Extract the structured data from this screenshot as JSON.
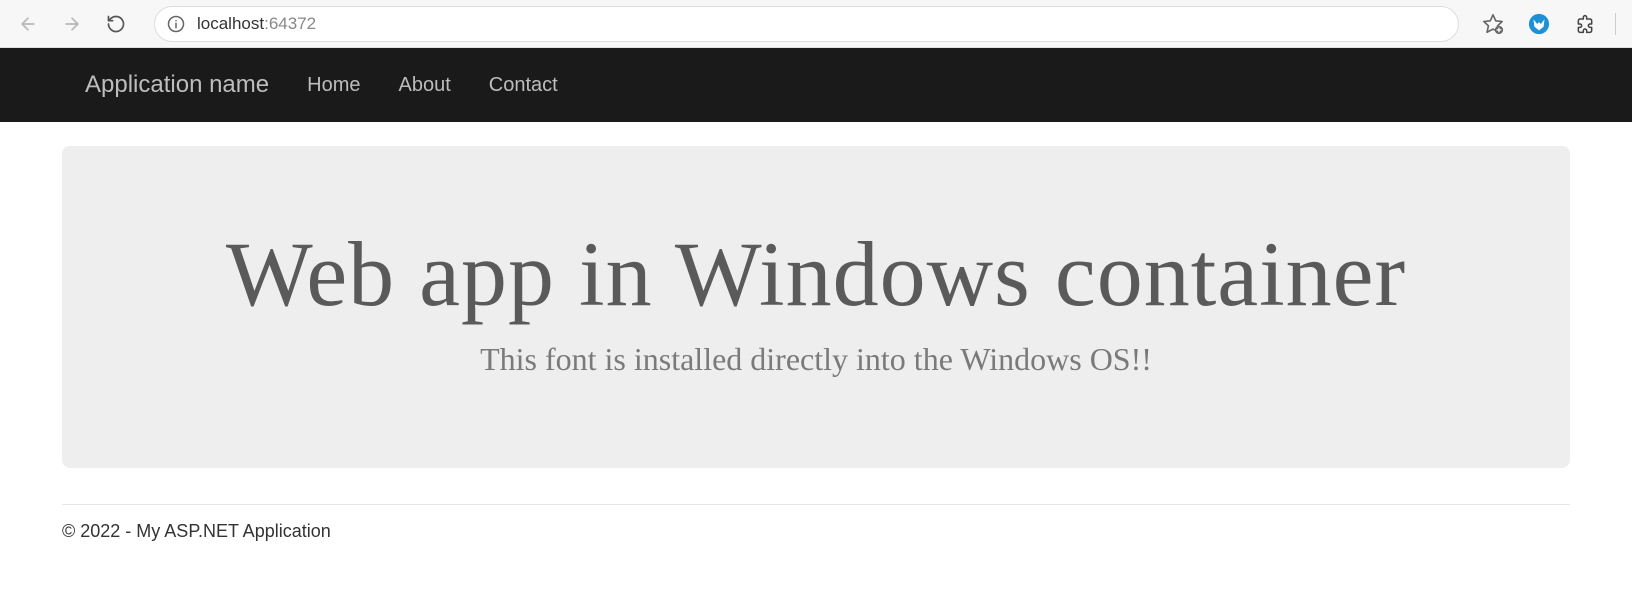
{
  "browser": {
    "url_host": "localhost",
    "url_port": ":64372"
  },
  "navbar": {
    "brand": "Application name",
    "links": [
      "Home",
      "About",
      "Contact"
    ]
  },
  "hero": {
    "title": "Web app in Windows container",
    "subtitle": "This font is installed directly into the Windows OS!!"
  },
  "footer": {
    "text": "© 2022 - My ASP.NET Application"
  }
}
